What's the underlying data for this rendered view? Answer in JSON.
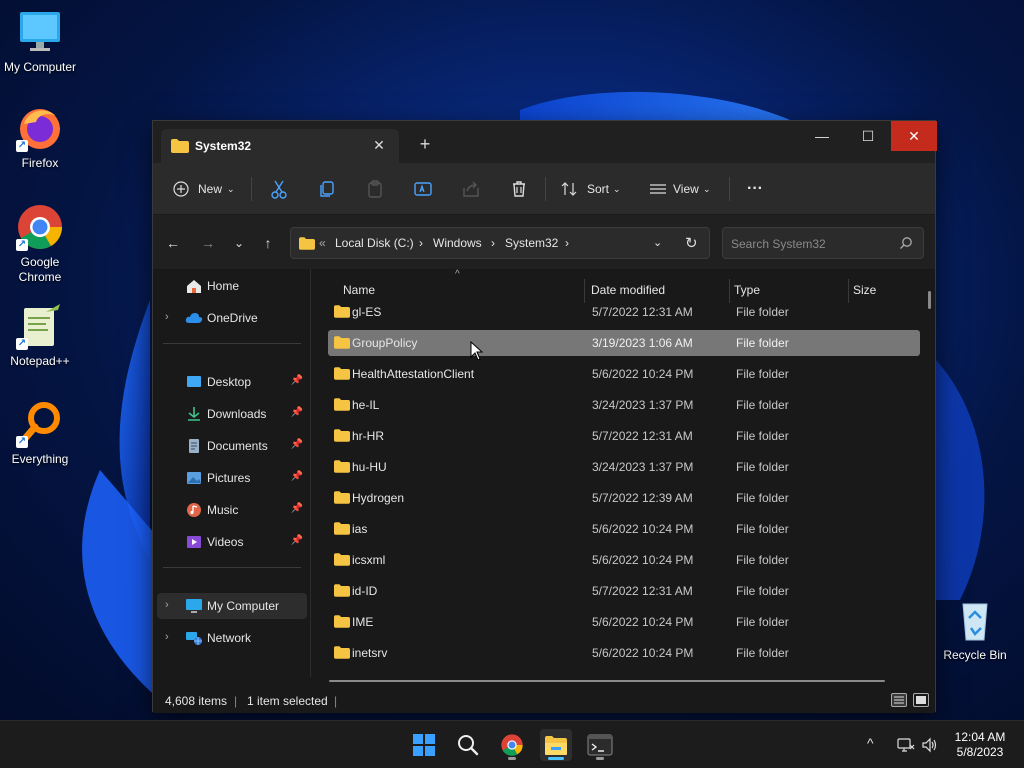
{
  "desktop": {
    "icons": [
      {
        "label": "My Computer",
        "icon": "monitor-icon"
      },
      {
        "label": "Firefox",
        "icon": "firefox-icon"
      },
      {
        "label": "Google Chrome",
        "icon": "chrome-icon"
      },
      {
        "label": "Notepad++",
        "icon": "notepadpp-icon"
      },
      {
        "label": "Everything",
        "icon": "everything-icon"
      },
      {
        "label": "Recycle Bin",
        "icon": "recycle-bin-icon"
      }
    ]
  },
  "window": {
    "tab_title": "System32",
    "toolbar": {
      "new_label": "New",
      "sort_label": "Sort",
      "view_label": "View",
      "more_label": "···"
    },
    "address": {
      "overflow": "«",
      "crumbs": [
        "Local Disk (C:)",
        "Windows",
        "System32"
      ]
    },
    "search": {
      "placeholder": "Search System32"
    },
    "nav": {
      "home": "Home",
      "onedrive": "OneDrive",
      "desktop": "Desktop",
      "downloads": "Downloads",
      "documents": "Documents",
      "pictures": "Pictures",
      "music": "Music",
      "videos": "Videos",
      "my_computer": "My Computer",
      "network": "Network"
    },
    "columns": {
      "name": "Name",
      "date": "Date modified",
      "type": "Type",
      "size": "Size"
    },
    "files": [
      {
        "name": "gl-ES",
        "date": "5/7/2022 12:31 AM",
        "type": "File folder"
      },
      {
        "name": "GroupPolicy",
        "date": "3/19/2023 1:06 AM",
        "type": "File folder"
      },
      {
        "name": "HealthAttestationClient",
        "date": "5/6/2022 10:24 PM",
        "type": "File folder"
      },
      {
        "name": "he-IL",
        "date": "3/24/2023 1:37 PM",
        "type": "File folder"
      },
      {
        "name": "hr-HR",
        "date": "5/7/2022 12:31 AM",
        "type": "File folder"
      },
      {
        "name": "hu-HU",
        "date": "3/24/2023 1:37 PM",
        "type": "File folder"
      },
      {
        "name": "Hydrogen",
        "date": "5/7/2022 12:39 AM",
        "type": "File folder"
      },
      {
        "name": "ias",
        "date": "5/6/2022 10:24 PM",
        "type": "File folder"
      },
      {
        "name": "icsxml",
        "date": "5/6/2022 10:24 PM",
        "type": "File folder"
      },
      {
        "name": "id-ID",
        "date": "5/7/2022 12:31 AM",
        "type": "File folder"
      },
      {
        "name": "IME",
        "date": "5/6/2022 10:24 PM",
        "type": "File folder"
      },
      {
        "name": "inetsrv",
        "date": "5/6/2022 10:24 PM",
        "type": "File folder"
      }
    ],
    "selected_file": "GroupPolicy",
    "status": {
      "count": "4,608 items",
      "sep": "|",
      "selected": "1 item selected"
    }
  },
  "taskbar": {
    "apps": [
      "start-icon",
      "search-icon",
      "chrome-icon",
      "file-explorer-icon",
      "terminal-icon"
    ],
    "clock": {
      "time": "12:04 AM",
      "date": "5/8/2023"
    },
    "tray_chevron": "^"
  },
  "colors": {
    "accent": "#4cc2ff",
    "folder": "#f5c443",
    "close_red": "#c42b1c",
    "selection": "#777777"
  }
}
